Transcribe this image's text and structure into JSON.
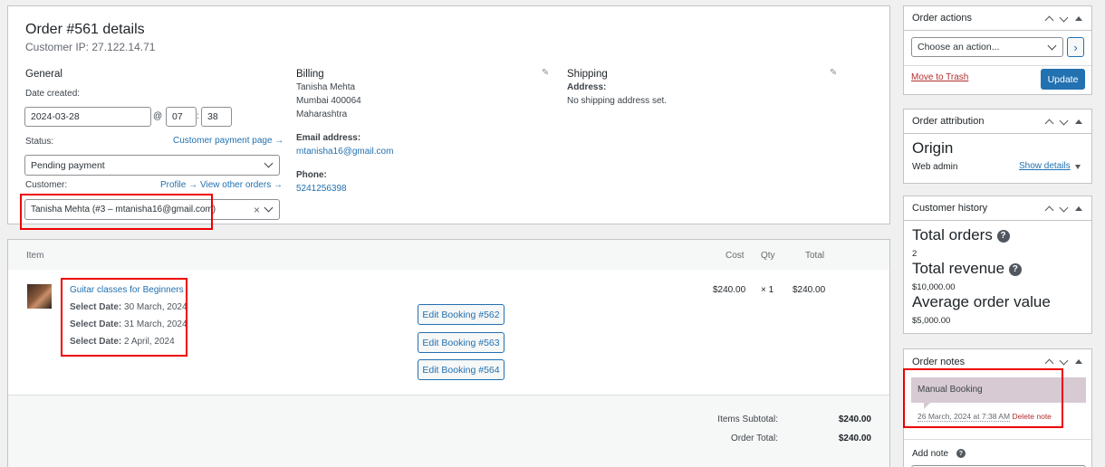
{
  "order": {
    "title": "Order #561 details",
    "customer_ip": "Customer IP: 27.122.14.71"
  },
  "general": {
    "heading": "General",
    "date_created_label": "Date created:",
    "date_value": "2024-03-28",
    "at_symbol": "@",
    "hour": "07",
    "minute": "38",
    "colon": ":",
    "status_label": "Status:",
    "customer_payment_link": "Customer payment page →",
    "status_value": "Pending payment",
    "customer_label": "Customer:",
    "profile_link": "Profile →",
    "other_orders_link": "View other orders →",
    "customer_value": "Tanisha Mehta (#3 – mtanisha16@gmail.com)",
    "clear_symbol": "×"
  },
  "billing": {
    "heading": "Billing",
    "name": "Tanisha Mehta",
    "city": "Mumbai 400064",
    "state": "Maharashtra",
    "email_label": "Email address:",
    "email": "mtanisha16@gmail.com",
    "phone_label": "Phone:",
    "phone": "5241256398"
  },
  "shipping": {
    "heading": "Shipping",
    "address_label": "Address:",
    "address_value": "No shipping address set."
  },
  "items": {
    "headers": {
      "item": "Item",
      "cost": "Cost",
      "qty": "Qty",
      "total": "Total"
    },
    "product_name": "Guitar classes for Beginners",
    "dates": [
      {
        "label": "Select Date:",
        "value": "30 March, 2024"
      },
      {
        "label": "Select Date:",
        "value": "31 March, 2024"
      },
      {
        "label": "Select Date:",
        "value": "2 April, 2024"
      }
    ],
    "bookings": [
      "Edit Booking #562",
      "Edit Booking #563",
      "Edit Booking #564"
    ],
    "cost": "$240.00",
    "qty": "× 1",
    "total": "$240.00",
    "subtotal_label": "Items Subtotal:",
    "subtotal_value": "$240.00",
    "order_total_label": "Order Total:",
    "order_total_value": "$240.00"
  },
  "sidebar": {
    "order_actions": {
      "title": "Order actions",
      "select_placeholder": "Choose an action...",
      "go_symbol": "›",
      "trash_link": "Move to Trash",
      "update_button": "Update"
    },
    "attribution": {
      "title": "Order attribution",
      "origin_heading": "Origin",
      "origin_value": "Web admin",
      "show_details": "Show details"
    },
    "history": {
      "title": "Customer history",
      "total_orders_label": "Total orders",
      "total_orders_value": "2",
      "total_revenue_label": "Total revenue",
      "total_revenue_value": "$10,000.00",
      "avg_label": "Average order value",
      "avg_value": "$5,000.00"
    },
    "notes": {
      "title": "Order notes",
      "note_text": "Manual Booking",
      "note_meta": "26 March, 2024 at 7:38 AM",
      "delete_note": "Delete note",
      "add_note_label": "Add note"
    }
  },
  "colors": {
    "accent": "#2271b1",
    "highlight_border": "#ee0000",
    "note_bg": "#d7cad2",
    "trash": "#b32d2e"
  }
}
